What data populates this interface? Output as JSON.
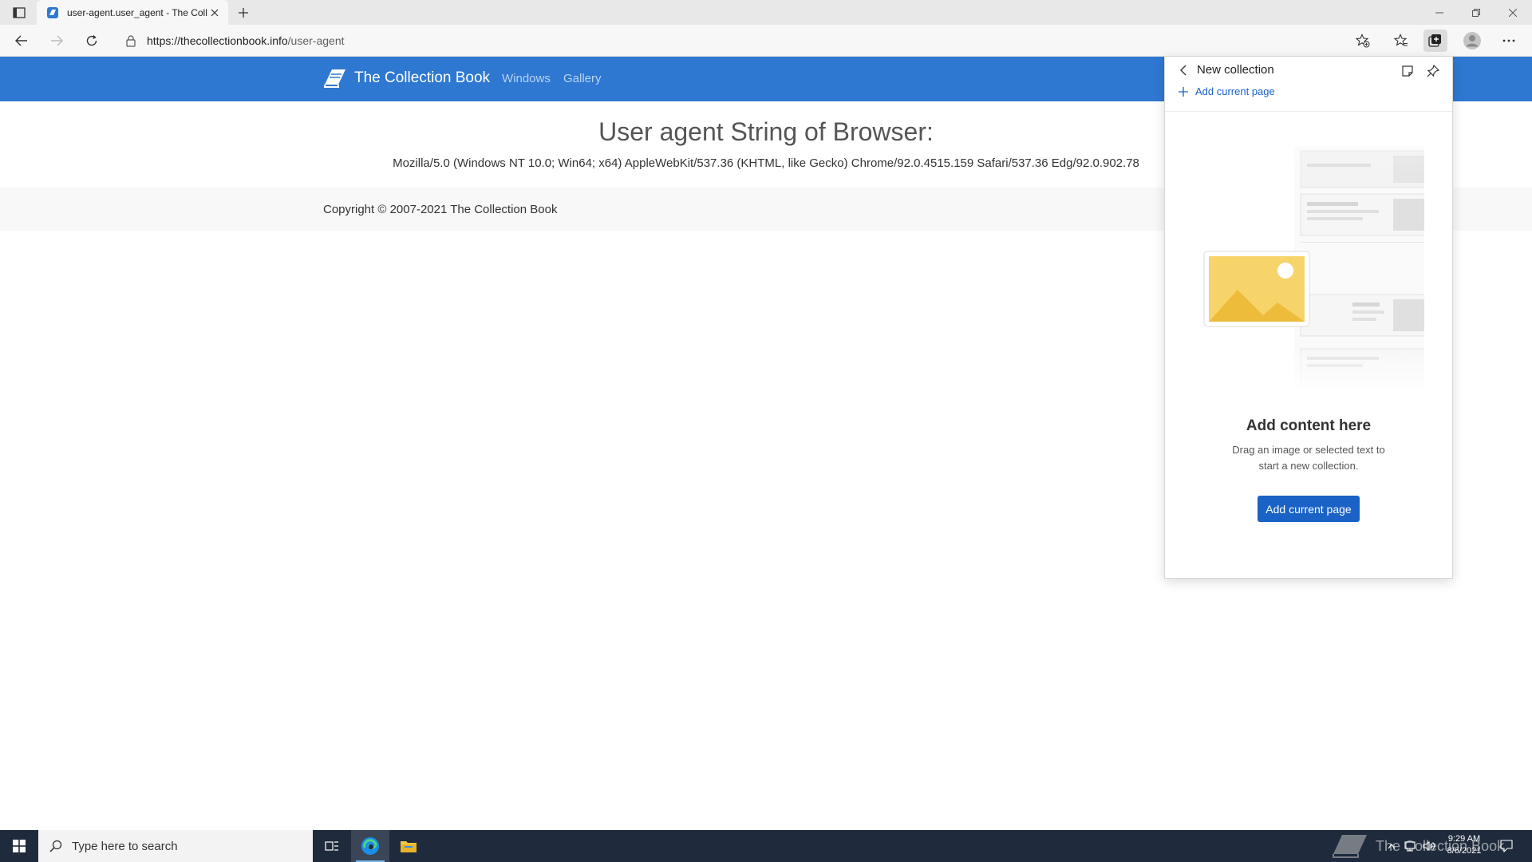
{
  "browser": {
    "tab": {
      "title": "user-agent.user_agent - The Collection Book"
    },
    "address": {
      "scheme_host": "https://thecollectionbook.info",
      "path": "/user-agent"
    }
  },
  "site": {
    "brand": "The Collection Book",
    "nav": [
      "Windows",
      "Gallery"
    ],
    "heading": "User agent String of Browser:",
    "user_agent": "Mozilla/5.0 (Windows NT 10.0; Win64; x64) AppleWebKit/537.36 (KHTML, like Gecko) Chrome/92.0.4515.159 Safari/537.36 Edg/92.0.902.78",
    "footer": "Copyright © 2007-2021 The Collection Book"
  },
  "collections": {
    "title": "New collection",
    "add_link": "Add current page",
    "empty_title": "Add content here",
    "empty_desc": "Drag an image or selected text to start a new collection.",
    "button": "Add current page"
  },
  "taskbar": {
    "search_placeholder": "Type here to search",
    "time": "9:29 AM",
    "date": "8/6/2021",
    "watermark": "The Collection Book"
  },
  "colors": {
    "site_nav": "#2e78d1",
    "accent": "#1a62c6",
    "taskbar": "#1f2b3c"
  }
}
